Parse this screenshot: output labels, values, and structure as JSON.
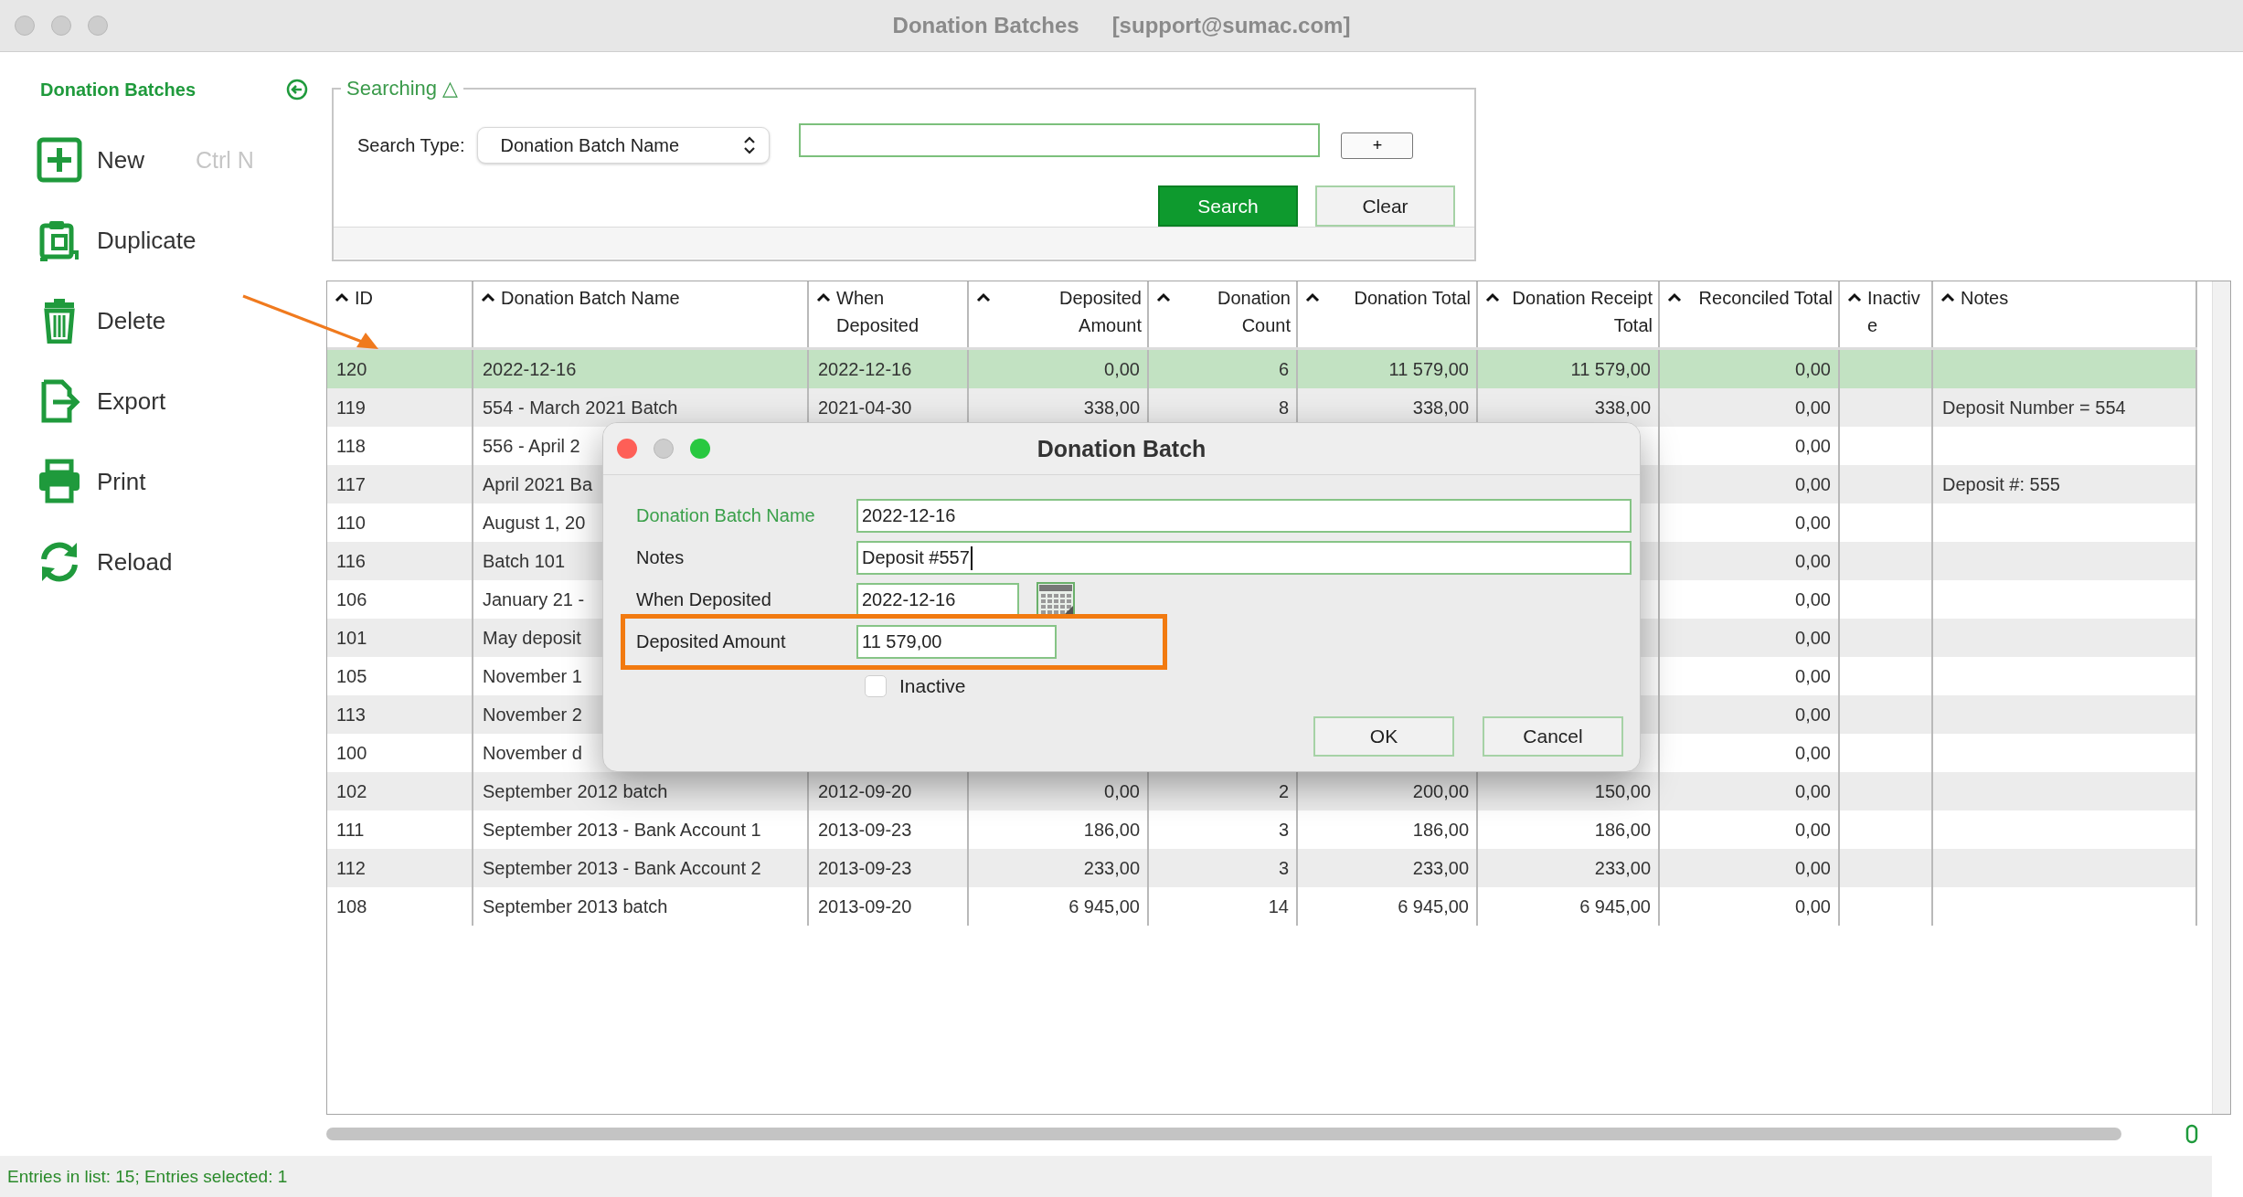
{
  "window": {
    "title": "Donation Batches",
    "account": "[support@sumac.com]"
  },
  "sidebar": {
    "title": "Donation Batches",
    "items": [
      {
        "kind": "new",
        "label": "New",
        "shortcut": "Ctrl N"
      },
      {
        "kind": "duplicate",
        "label": "Duplicate"
      },
      {
        "kind": "delete",
        "label": "Delete"
      },
      {
        "kind": "export",
        "label": "Export"
      },
      {
        "kind": "print",
        "label": "Print"
      },
      {
        "kind": "reload",
        "label": "Reload"
      }
    ]
  },
  "search": {
    "legend": "Searching △",
    "type_label": "Search Type:",
    "type_value": "Donation Batch Name",
    "add_button": "+",
    "buttons": [
      {
        "label": "Search",
        "primary": true
      },
      {
        "label": "Clear",
        "primary": false
      }
    ]
  },
  "table": {
    "columns": [
      {
        "label": "ID",
        "kind": "text"
      },
      {
        "label": "Donation Batch Name",
        "kind": "text"
      },
      {
        "label": "When Deposited",
        "kind": "text"
      },
      {
        "label": "Deposited Amount",
        "kind": "number"
      },
      {
        "label": "Donation Count",
        "kind": "number"
      },
      {
        "label": "Donation Total",
        "kind": "number"
      },
      {
        "label": "Donation Receipt Total",
        "kind": "number"
      },
      {
        "label": "Reconciled Total",
        "kind": "number"
      },
      {
        "label": "Inactive",
        "kind": "text"
      },
      {
        "label": "Notes",
        "kind": "text"
      }
    ],
    "rows": [
      {
        "selected": true,
        "cells": [
          "120",
          "2022-12-16",
          "2022-12-16",
          "0,00",
          "6",
          "11 579,00",
          "11 579,00",
          "0,00",
          null,
          null
        ]
      },
      {
        "selected": false,
        "cells": [
          "119",
          "554 - March 2021 Batch",
          "2021-04-30",
          "338,00",
          "8",
          "338,00",
          "338,00",
          "0,00",
          null,
          "Deposit Number = 554"
        ]
      },
      {
        "selected": false,
        "cells": [
          "118",
          "556 - April 2",
          null,
          null,
          null,
          null,
          null,
          "0,00",
          null,
          null
        ]
      },
      {
        "selected": false,
        "cells": [
          "117",
          "April 2021 Ba",
          null,
          null,
          null,
          null,
          null,
          "0,00",
          null,
          "Deposit #: 555"
        ]
      },
      {
        "selected": false,
        "cells": [
          "110",
          "August 1, 20",
          null,
          null,
          null,
          null,
          null,
          "0,00",
          null,
          null
        ]
      },
      {
        "selected": false,
        "cells": [
          "116",
          "Batch 101",
          null,
          null,
          null,
          null,
          null,
          "0,00",
          null,
          null
        ]
      },
      {
        "selected": false,
        "cells": [
          "106",
          "January 21 -",
          null,
          null,
          null,
          null,
          null,
          "0,00",
          null,
          null
        ]
      },
      {
        "selected": false,
        "cells": [
          "101",
          "May deposit",
          null,
          null,
          null,
          null,
          null,
          "0,00",
          null,
          null
        ]
      },
      {
        "selected": false,
        "cells": [
          "105",
          "November 1",
          null,
          null,
          null,
          null,
          null,
          "0,00",
          null,
          null
        ]
      },
      {
        "selected": false,
        "cells": [
          "113",
          "November 2",
          null,
          null,
          null,
          null,
          null,
          "0,00",
          null,
          null
        ]
      },
      {
        "selected": false,
        "cells": [
          "100",
          "November d",
          null,
          null,
          null,
          null,
          null,
          "0,00",
          null,
          null
        ]
      },
      {
        "selected": false,
        "cells": [
          "102",
          "September 2012 batch",
          "2012-09-20",
          "0,00",
          "2",
          "200,00",
          "150,00",
          "0,00",
          null,
          null
        ]
      },
      {
        "selected": false,
        "cells": [
          "111",
          "September 2013 - Bank Account 1",
          "2013-09-23",
          "186,00",
          "3",
          "186,00",
          "186,00",
          "0,00",
          null,
          null
        ]
      },
      {
        "selected": false,
        "cells": [
          "112",
          "September 2013 - Bank Account 2",
          "2013-09-23",
          "233,00",
          "3",
          "233,00",
          "233,00",
          "0,00",
          null,
          null
        ]
      },
      {
        "selected": false,
        "cells": [
          "108",
          "September 2013 batch",
          "2013-09-20",
          "6 945,00",
          "14",
          "6 945,00",
          "6 945,00",
          "0,00",
          null,
          null
        ]
      }
    ]
  },
  "dialog": {
    "title": "Donation Batch",
    "fields": [
      {
        "kind": "text",
        "label": "Donation Batch Name",
        "value": "2022-12-16",
        "required": true,
        "focused": false,
        "highlighted": false
      },
      {
        "kind": "text",
        "label": "Notes",
        "value": "Deposit #557",
        "required": false,
        "focused": true,
        "highlighted": false
      },
      {
        "kind": "date",
        "label": "When Deposited",
        "value": "2022-12-16",
        "required": false,
        "focused": false,
        "highlighted": false
      },
      {
        "kind": "amount",
        "label": "Deposited Amount",
        "value": "11 579,00",
        "required": false,
        "focused": false,
        "highlighted": true
      }
    ],
    "checkbox": {
      "label": "Inactive",
      "checked": false
    },
    "buttons": [
      "OK",
      "Cancel"
    ]
  },
  "status_bar": "Entries in list: 15; Entries selected: 1"
}
